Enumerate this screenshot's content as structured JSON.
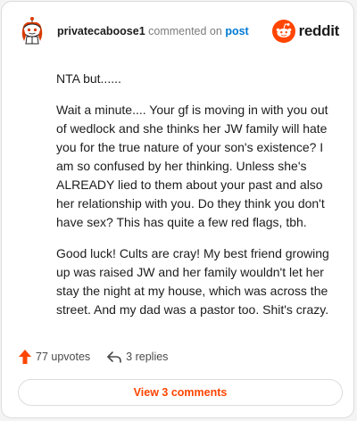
{
  "header": {
    "username": "privatecaboose1",
    "verb": "commented on",
    "post_link": "post",
    "brand": "reddit",
    "brand_color": "#ff4500",
    "link_color": "#0079d3"
  },
  "comment": {
    "paragraphs": [
      "NTA but......",
      "Wait a minute.... Your gf is moving in with you out of wedlock and she thinks her JW family will hate you for the true nature of your son's existence? I am so confused by her thinking. Unless she's ALREADY lied to them about your past and also her relationship with you. Do they think you don't have sex? This has quite a few red flags, tbh.",
      "Good luck! Cults are cray! My best friend growing up was raised JW and her family wouldn't let her stay the night at my house, which was across the street. And my dad was a pastor too. Shit's crazy."
    ]
  },
  "actions": {
    "upvotes": "77 upvotes",
    "replies": "3 replies",
    "upvote_icon": "upvote-arrow-icon",
    "reply_icon": "reply-arrow-icon"
  },
  "footer": {
    "view_comments": "View 3 comments"
  }
}
